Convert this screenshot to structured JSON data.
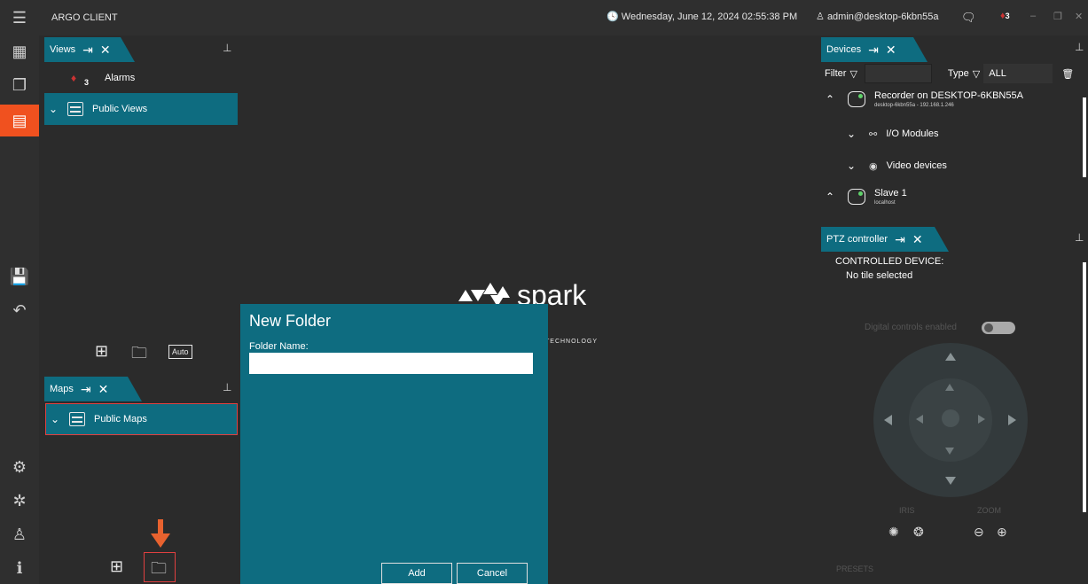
{
  "app": {
    "title": "ARGO CLIENT"
  },
  "status": {
    "datetime": "Wednesday, June 12, 2024 02:55:38 PM",
    "user": "admin@desktop-6kbn55a",
    "alarm_count": "3"
  },
  "views_panel": {
    "tab_label": "Views",
    "alarms_label": "Alarms",
    "alarms_count": "3",
    "public_views_label": "Public Views",
    "auto_label": "Auto"
  },
  "maps_panel": {
    "tab_label": "Maps",
    "public_maps_label": "Public Maps"
  },
  "logo": {
    "word": "spark",
    "sub": "TECHNOLOGY"
  },
  "dialog": {
    "title": "New Folder",
    "field_label": "Folder Name:",
    "field_value": "",
    "add_label": "Add",
    "cancel_label": "Cancel"
  },
  "devices_panel": {
    "tab_label": "Devices",
    "filter_label": "Filter",
    "type_label": "Type",
    "type_value": "ALL",
    "recorder_name": "Recorder on DESKTOP-6KBN55A",
    "recorder_sub": "desktop-6kbn55a - 192.168.1.246",
    "io_modules_label": "I/O Modules",
    "video_devices_label": "Video devices",
    "slave_name": "Slave 1",
    "slave_sub": "localhost"
  },
  "ptz_panel": {
    "tab_label": "PTZ controller",
    "controlled_device_label": "CONTROLLED DEVICE:",
    "no_tile_label": "No tile selected",
    "digital_controls_label": "Digital controls enabled",
    "iris_label": "IRIS",
    "zoom_label": "ZOOM",
    "presets_label": "PRESETS"
  }
}
